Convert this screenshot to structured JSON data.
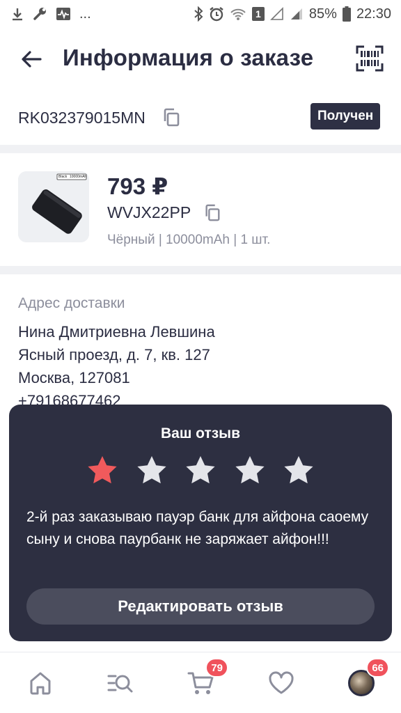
{
  "status_bar": {
    "battery_percent": "85%",
    "time": "22:30",
    "sim_badge": "1",
    "more": "..."
  },
  "header": {
    "title": "Информация о заказе"
  },
  "order": {
    "number": "RK032379015MN",
    "status": "Получен"
  },
  "product": {
    "price": "793 ₽",
    "sku": "WVJX22PP",
    "meta": "Чёрный | 10000mAh | 1 шт.",
    "thumb_labels": [
      "Black",
      "10000mAh"
    ]
  },
  "address": {
    "label": "Адрес доставки",
    "lines": [
      "Нина Дмитриевна Левшина",
      "Ясный проезд, д. 7, кв. 127",
      "Москва, 127081",
      "+79168677462"
    ]
  },
  "review": {
    "title": "Ваш отзыв",
    "rating": 1,
    "max_rating": 5,
    "star_active_color": "#f05a5c",
    "star_inactive_color": "#e4e5ea",
    "text": "2-й раз заказываю пауэр банк для айфона саоему сыну и снова паурбанк не заряжает айфон!!!",
    "edit_button": "Редактировать отзыв"
  },
  "bottom_nav": {
    "items": [
      {
        "name": "home",
        "icon": "home-icon"
      },
      {
        "name": "catalog",
        "icon": "catalog-search-icon"
      },
      {
        "name": "cart",
        "icon": "cart-icon",
        "badge": "79"
      },
      {
        "name": "favorites",
        "icon": "heart-icon"
      },
      {
        "name": "profile",
        "icon": "avatar",
        "badge": "66"
      }
    ]
  },
  "colors": {
    "primary_text": "#2b2d42",
    "secondary_text": "#8c8e9c",
    "card_bg": "#2d2f41",
    "badge_red": "#f0525c"
  }
}
